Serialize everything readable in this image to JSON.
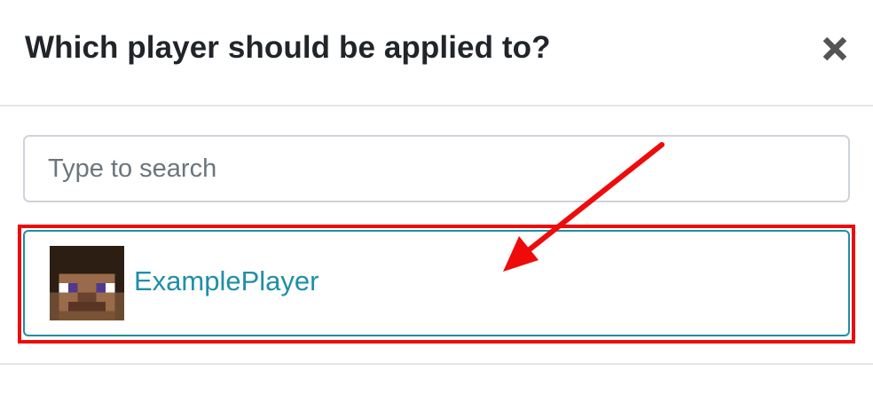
{
  "dialog": {
    "title": "Which player should be applied to?",
    "close_icon": "close-icon"
  },
  "search": {
    "placeholder": "Type to search",
    "value": ""
  },
  "players": [
    {
      "name": "ExamplePlayer",
      "avatar_icon": "player-head-icon"
    }
  ],
  "colors": {
    "title": "#212529",
    "link": "#1f8fa6",
    "highlight": "#ef0b0b",
    "divider": "#e3e6ea",
    "input_border": "#ced4da"
  }
}
